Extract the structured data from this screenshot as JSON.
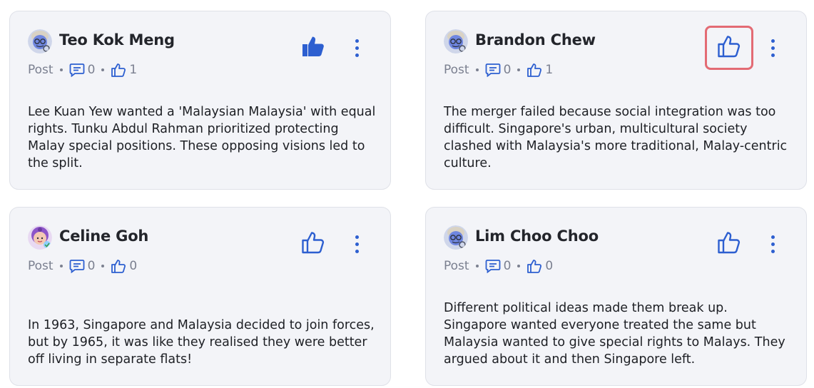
{
  "posts": [
    {
      "author": "Teo Kok Meng",
      "type_label": "Post",
      "comment_count": "0",
      "like_count": "1",
      "liked": true,
      "avatar_icon": "elderly-man-avatar-icon",
      "body": "Lee Kuan Yew wanted a 'Malaysian Malaysia' with equal rights. Tunku Abdul Rahman prioritized protecting Malay special positions. These opposing visions led to the split."
    },
    {
      "author": "Brandon Chew",
      "type_label": "Post",
      "comment_count": "0",
      "like_count": "1",
      "liked": false,
      "avatar_icon": "elderly-man-avatar-icon",
      "body": "The merger failed because social integration was too difficult. Singapore's urban, multicultural society clashed with Malaysia's more traditional, Malay-centric culture."
    },
    {
      "author": "Celine Goh",
      "type_label": "Post",
      "comment_count": "0",
      "like_count": "0",
      "liked": false,
      "avatar_icon": "woman-avatar-icon",
      "body": "In 1963, Singapore and Malaysia decided to join forces, but by 1965, it was like they realised they were better off living in separate flats!"
    },
    {
      "author": "Lim Choo Choo",
      "type_label": "Post",
      "comment_count": "0",
      "like_count": "0",
      "liked": false,
      "avatar_icon": "elderly-man-avatar-icon",
      "body": "Different political ideas made them break up. Singapore wanted everyone treated the same but Malaysia wanted to give special rights to Malays. They argued about it and then Singapore left."
    }
  ],
  "colors": {
    "accent": "#2d5fd0",
    "card_bg": "#f3f4f8",
    "focus_ring": "#e36b74",
    "meta_text": "#7b8090"
  }
}
